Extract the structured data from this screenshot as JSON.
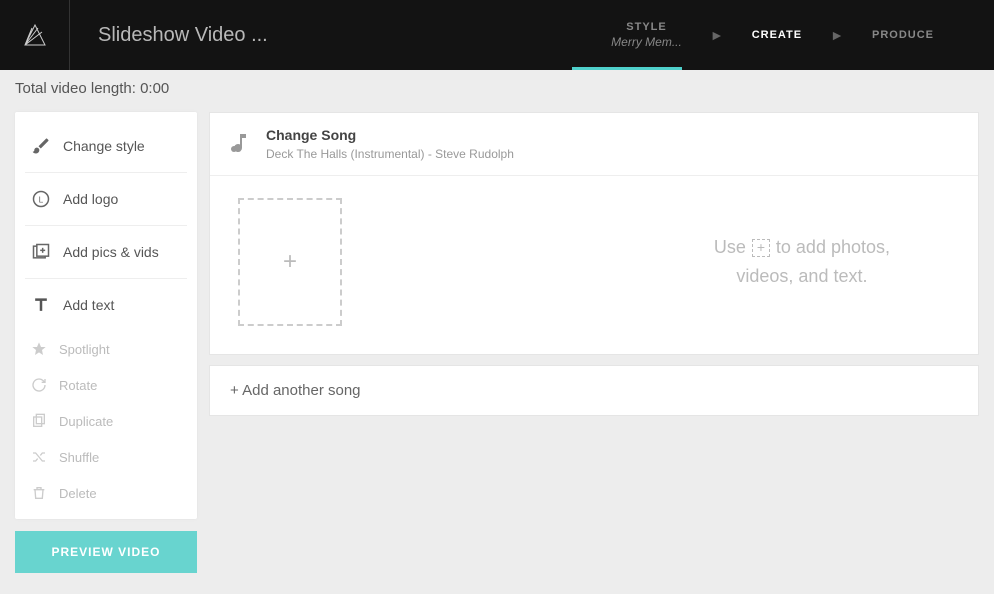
{
  "header": {
    "project_title": "Slideshow Video ...",
    "steps": {
      "style": {
        "label": "STYLE",
        "subtitle": "Merry Mem..."
      },
      "create": {
        "label": "CREATE"
      },
      "produce": {
        "label": "PRODUCE"
      }
    }
  },
  "length_bar": "Total video length: 0:00",
  "sidebar": {
    "primary": {
      "change_style": "Change style",
      "add_logo": "Add logo",
      "add_pics": "Add pics & vids",
      "add_text": "Add text"
    },
    "secondary": {
      "spotlight": "Spotlight",
      "rotate": "Rotate",
      "duplicate": "Duplicate",
      "shuffle": "Shuffle",
      "delete": "Delete"
    },
    "preview_button": "PREVIEW VIDEO"
  },
  "song": {
    "change_label": "Change Song",
    "meta": "Deck The Halls (Instrumental) - Steve Rudolph"
  },
  "hint": {
    "line1_a": "Use",
    "line1_b": "to add photos,",
    "line2": "videos, and text."
  },
  "add_song_bar": "+ Add another song"
}
